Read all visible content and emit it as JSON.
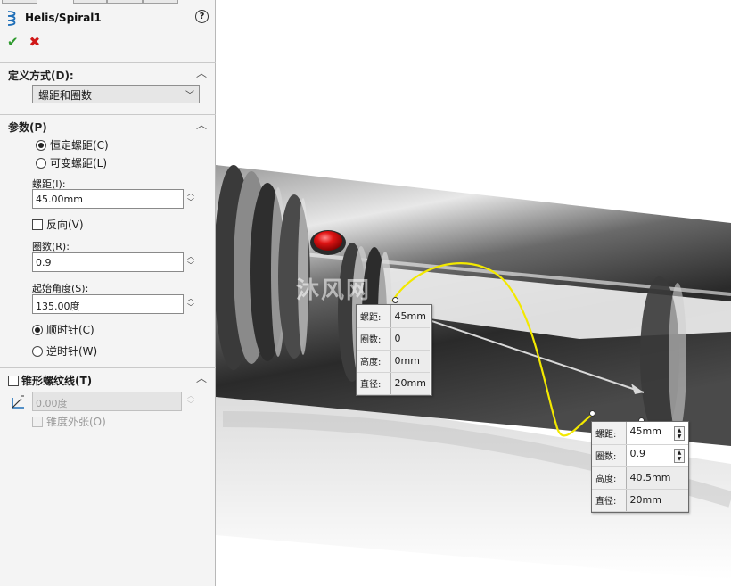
{
  "feature": {
    "title": "Helis/Spiral1",
    "icon": "helix-icon",
    "help_icon": "help-icon",
    "ok_icon": "check-icon",
    "cancel_icon": "close-icon"
  },
  "define_by": {
    "header": "定义方式(D):",
    "value": "螺距和圈数"
  },
  "parameters": {
    "header": "参数(P)",
    "constant_pitch_label": "恒定螺距(C)",
    "variable_pitch_label": "可变螺距(L)",
    "pitch_label": "螺距(I):",
    "pitch_value": "45.00mm",
    "reverse_label": "反向(V)",
    "revolutions_label": "圈数(R):",
    "revolutions_value": "0.9",
    "start_angle_label": "起始角度(S):",
    "start_angle_value": "135.00度",
    "clockwise_label": "顺时针(C)",
    "counterclockwise_label": "逆时针(W)"
  },
  "taper": {
    "header": "锥形螺纹线(T)",
    "angle_value": "0.00度",
    "taper_outward_label": "锥度外张(O)"
  },
  "callout_start": {
    "rows": [
      {
        "key": "螺距:",
        "value": "45mm"
      },
      {
        "key": "圈数:",
        "value": "0"
      },
      {
        "key": "高度:",
        "value": "0mm"
      },
      {
        "key": "直径:",
        "value": "20mm"
      }
    ]
  },
  "callout_end": {
    "rows": [
      {
        "key": "螺距:",
        "value": "45mm"
      },
      {
        "key": "圈数:",
        "value": "0.9"
      },
      {
        "key": "高度:",
        "value": "40.5mm"
      },
      {
        "key": "直径:",
        "value": "20mm"
      }
    ]
  },
  "watermark": "沐风网",
  "colors": {
    "ok": "#2e9a2e",
    "cancel": "#d01818",
    "helix_curve": "#f2e800",
    "button_red": "#e01414",
    "body_gray": "#5a5a5a"
  }
}
